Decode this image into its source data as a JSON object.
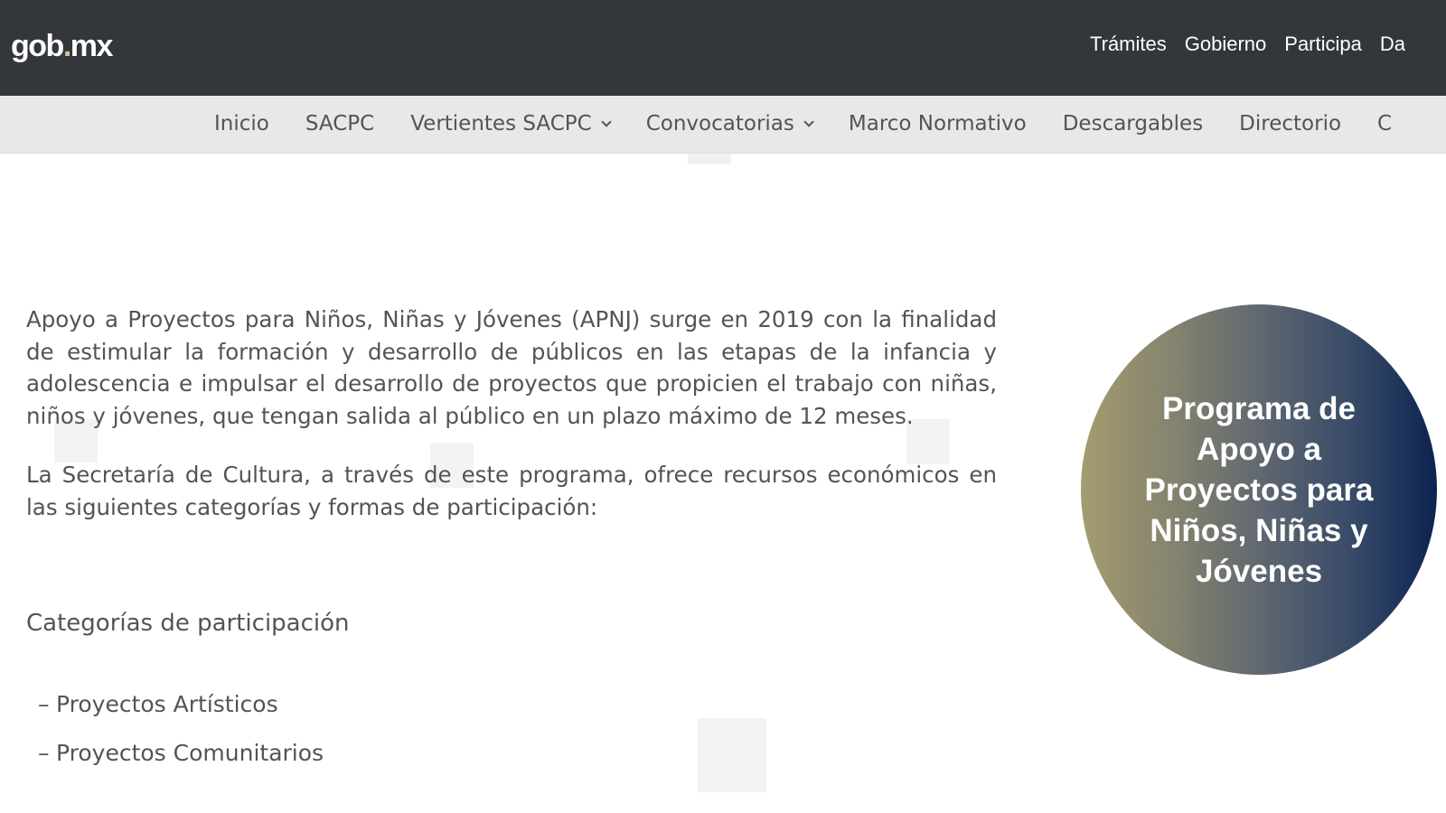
{
  "header": {
    "logo_main": "gob",
    "logo_dot": ".",
    "logo_suffix": "mx",
    "nav": [
      "Trámites",
      "Gobierno",
      "Participa",
      "Da"
    ]
  },
  "subnav": {
    "items": [
      {
        "label": "Inicio"
      },
      {
        "label": "SACPC"
      },
      {
        "label": "Vertientes SACPC"
      },
      {
        "label": "Convocatorias"
      },
      {
        "label": "Marco Normativo"
      },
      {
        "label": "Descargables"
      },
      {
        "label": "Directorio"
      },
      {
        "label": "C"
      }
    ]
  },
  "main": {
    "paragraph_1": "Apoyo a Proyectos para Niños, Niñas y Jóvenes (APNJ) surge en 2019 con la finalidad de estimular la formación y desarrollo de públicos en las etapas de la infancia y adolescencia e impulsar el desarrollo de proyectos que propicien el trabajo con niñas, niños y jóvenes, que tengan salida al público en un plazo máximo de 12 meses.",
    "paragraph_2": "La Secretaría de Cultura, a través de este programa, ofrece recursos económicos en las siguientes categorías y formas de participación:",
    "categories_heading": "Categorías de participación",
    "categories": [
      {
        "dash": "–",
        "label": "Proyectos Artísticos"
      },
      {
        "dash": "–",
        "label": "Proyectos Comunitarios"
      }
    ]
  },
  "program_badge": {
    "line_1": "Programa de",
    "line_2": "Apoyo a",
    "line_3": "Proyectos para",
    "line_4": "Niños, Niñas y",
    "line_5": "Jóvenes"
  }
}
